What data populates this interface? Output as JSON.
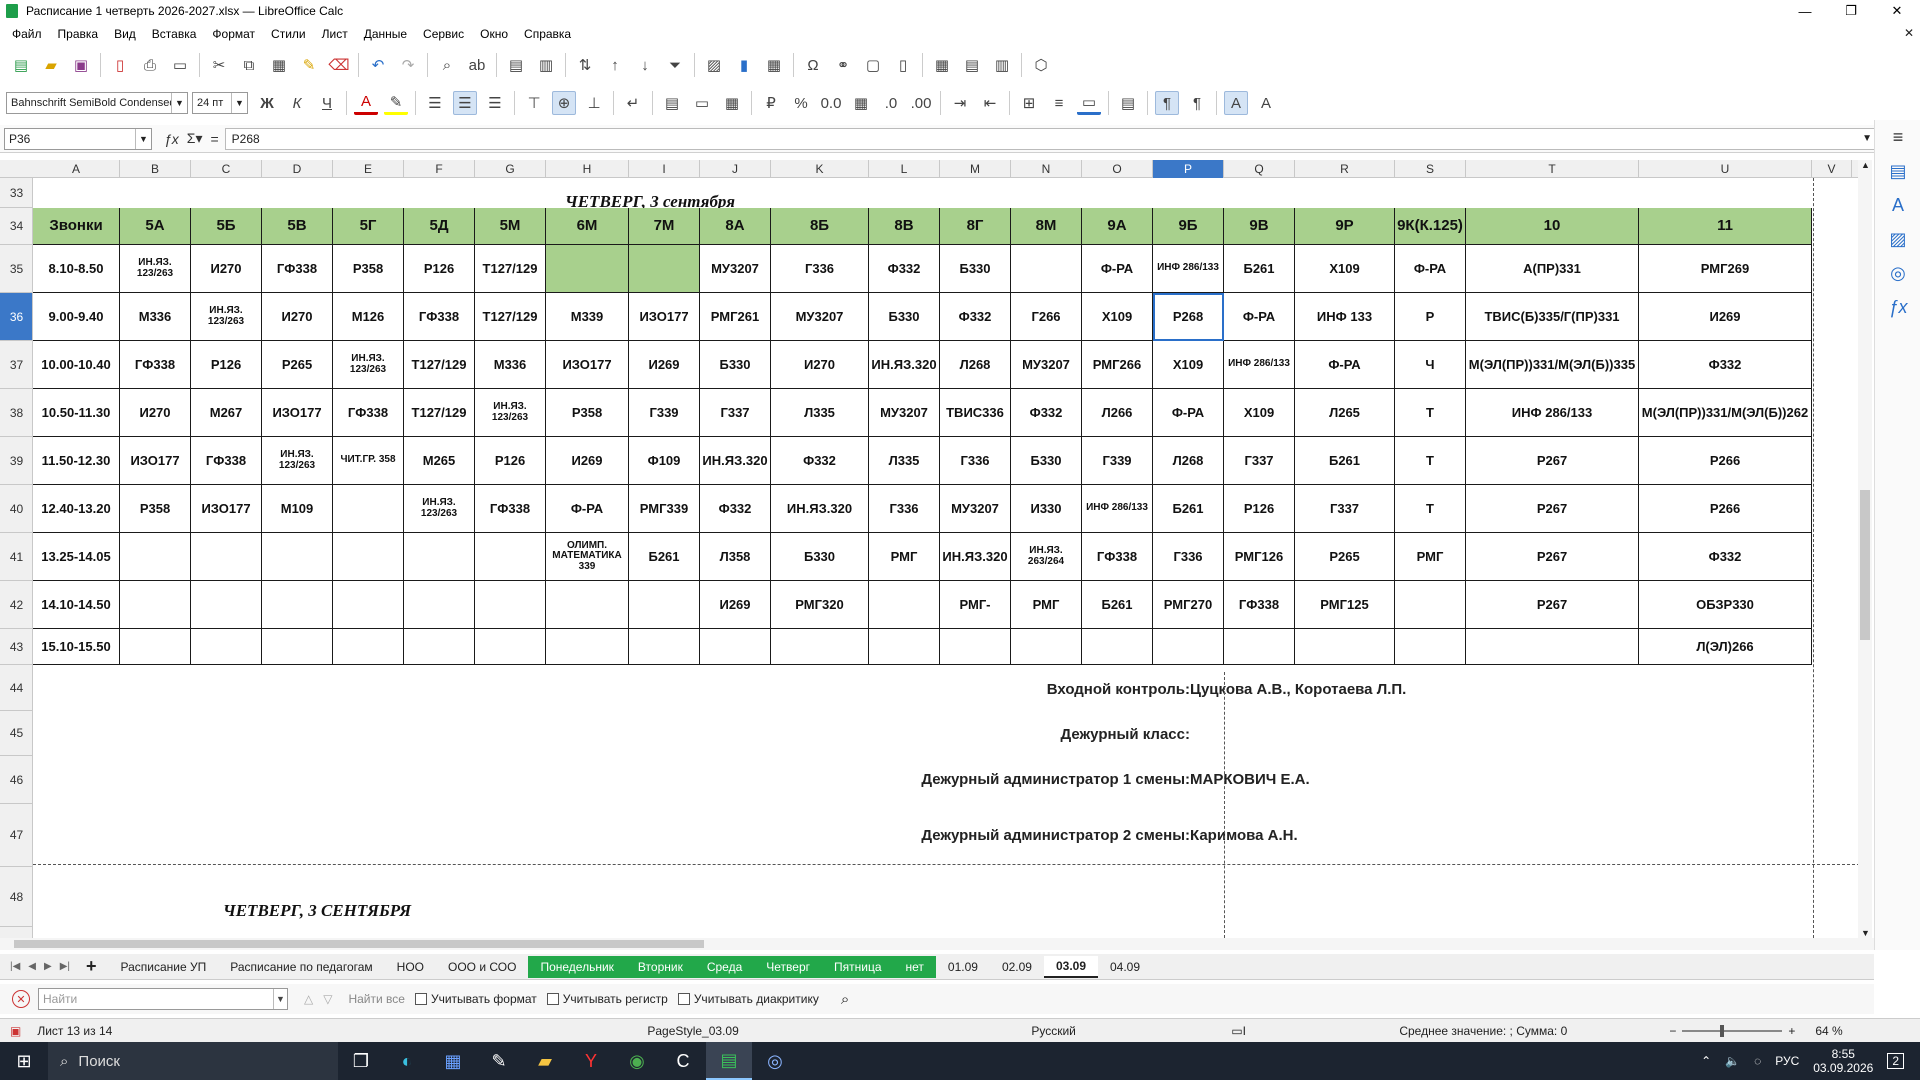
{
  "window": {
    "title": "Расписание 1 четверть 2026-2027.xlsx — LibreOffice Calc",
    "minimize": "—",
    "maximize": "❐",
    "close": "✕"
  },
  "menu": [
    "Файл",
    "Правка",
    "Вид",
    "Вставка",
    "Формат",
    "Стили",
    "Лист",
    "Данные",
    "Сервис",
    "Окно",
    "Справка"
  ],
  "font": {
    "name": "Bahnschrift SemiBold Condensed",
    "size": "24 пт"
  },
  "formula": {
    "cell_ref": "P36",
    "content": "Р268"
  },
  "columns": [
    "A",
    "B",
    "C",
    "D",
    "E",
    "F",
    "G",
    "H",
    "I",
    "J",
    "K",
    "L",
    "M",
    "N",
    "O",
    "P",
    "Q",
    "R",
    "S",
    "T",
    "U",
    "V"
  ],
  "selected_column": "P",
  "rows": [
    "33",
    "34",
    "35",
    "36",
    "37",
    "38",
    "39",
    "40",
    "41",
    "42",
    "43",
    "44",
    "45",
    "46",
    "47",
    "48"
  ],
  "selected_row": "36",
  "day_title_1": "ЧЕТВЕРГ, 3 сентября",
  "day_title_2": "ЧЕТВЕРГ, 3 СЕНТЯБРЯ",
  "schedule": {
    "header": [
      "Звонки",
      "5А",
      "5Б",
      "5В",
      "5Г",
      "5Д",
      "5М",
      "6М",
      "7М",
      "8А",
      "8Б",
      "8В",
      "8Г",
      "8М",
      "9А",
      "9Б",
      "9В",
      "9Р",
      "9К(К.125)",
      "10",
      "11"
    ],
    "rows": [
      [
        "8.10-8.50",
        "ИН.ЯЗ. 123/263",
        "И270",
        "ГФ338",
        "Р358",
        "Р126",
        "Т127/129",
        "",
        "",
        "МУ3207",
        "Г336",
        "Ф332",
        "Б330",
        "",
        "Ф-РА",
        "ИНФ 286/133",
        "Б261",
        "Х109",
        "Ф-РА",
        "А(ПР)331",
        "РМГ269"
      ],
      [
        "9.00-9.40",
        "М336",
        "ИН.ЯЗ. 123/263",
        "И270",
        "М126",
        "ГФ338",
        "Т127/129",
        "М339",
        "ИЗО177",
        "РМГ261",
        "МУ3207",
        "Б330",
        "Ф332",
        "Г266",
        "Х109",
        "Р268",
        "Ф-РА",
        "ИНФ 133",
        "Р",
        "ТВИС(Б)335/Г(ПР)331",
        "И269"
      ],
      [
        "10.00-10.40",
        "ГФ338",
        "Р126",
        "Р265",
        "ИН.ЯЗ. 123/263",
        "Т127/129",
        "М336",
        "ИЗО177",
        "И269",
        "Б330",
        "И270",
        "ИН.ЯЗ.320",
        "Л268",
        "МУ3207",
        "РМГ266",
        "Х109",
        "ИНФ 286/133",
        "Ф-РА",
        "Ч",
        "М(ЭЛ(ПР))331/М(ЭЛ(Б))335",
        "Ф332"
      ],
      [
        "10.50-11.30",
        "И270",
        "М267",
        "ИЗО177",
        "ГФ338",
        "Т127/129",
        "ИН.ЯЗ. 123/263",
        "Р358",
        "Г339",
        "Г337",
        "Л335",
        "МУ3207",
        "ТВИС336",
        "Ф332",
        "Л266",
        "Ф-РА",
        "Х109",
        "Л265",
        "Т",
        "ИНФ 286/133",
        "М(ЭЛ(ПР))331/М(ЭЛ(Б))262"
      ],
      [
        "11.50-12.30",
        "ИЗО177",
        "ГФ338",
        "ИН.ЯЗ. 123/263",
        "ЧИТ.ГР. 358",
        "М265",
        "Р126",
        "И269",
        "Ф109",
        "ИН.ЯЗ.320",
        "Ф332",
        "Л335",
        "Г336",
        "Б330",
        "Г339",
        "Л268",
        "Г337",
        "Б261",
        "Т",
        "Р267",
        "Р266"
      ],
      [
        "12.40-13.20",
        "Р358",
        "ИЗО177",
        "М109",
        "",
        "ИН.ЯЗ. 123/263",
        "ГФ338",
        "Ф-РА",
        "РМГ339",
        "Ф332",
        "ИН.ЯЗ.320",
        "Г336",
        "МУ3207",
        "И330",
        "ИНФ 286/133",
        "Б261",
        "Р126",
        "Г337",
        "Т",
        "Р267",
        "Р266"
      ],
      [
        "13.25-14.05",
        "",
        "",
        "",
        "",
        "",
        "",
        "ОЛИМП. МАТЕМАТИКА 339",
        "Б261",
        "Л358",
        "Б330",
        "РМГ",
        "ИН.ЯЗ.320",
        "ИН.ЯЗ. 263/264",
        "ГФ338",
        "Г336",
        "РМГ126",
        "Р265",
        "РМГ",
        "Р267",
        "Ф332"
      ],
      [
        "14.10-14.50",
        "",
        "",
        "",
        "",
        "",
        "",
        "",
        "",
        "И269",
        "РМГ320",
        "",
        "РМГ-",
        "РМГ",
        "Б261",
        "РМГ270",
        "ГФ338",
        "РМГ125",
        "",
        "Р267",
        "ОБЗР330"
      ],
      [
        "15.10-15.50",
        "",
        "",
        "",
        "",
        "",
        "",
        "",
        "",
        "",
        "",
        "",
        "",
        "",
        "",
        "",
        "",
        "",
        "",
        "",
        "Л(ЭЛ)266"
      ]
    ]
  },
  "info": {
    "entry_label": "Входной контроль:",
    "entry_value": "Цуцкова А.В., Коротаева Л.П.",
    "duty_class_label": "Дежурный класс:",
    "duty_class_value": "",
    "admin1_label": "Дежурный администратор 1 смены:",
    "admin1_value": "МАРКОВИЧ Е.А.",
    "admin2_label": "Дежурный администратор 2 смены:",
    "admin2_value": "Каримова А.Н."
  },
  "tabs": [
    {
      "label": "Расписание УП",
      "style": "normal"
    },
    {
      "label": "Расписание по педагогам",
      "style": "normal"
    },
    {
      "label": "НОО",
      "style": "normal"
    },
    {
      "label": "ООО и СОО",
      "style": "normal"
    },
    {
      "label": "Понедельник",
      "style": "green"
    },
    {
      "label": "Вторник",
      "style": "green"
    },
    {
      "label": "Среда",
      "style": "green"
    },
    {
      "label": "Четверг",
      "style": "green"
    },
    {
      "label": "Пятница",
      "style": "green"
    },
    {
      "label": "нет",
      "style": "green"
    },
    {
      "label": "01.09",
      "style": "normal"
    },
    {
      "label": "02.09",
      "style": "normal"
    },
    {
      "label": "03.09",
      "style": "active"
    },
    {
      "label": "04.09",
      "style": "normal"
    }
  ],
  "find": {
    "placeholder": "Найти",
    "find_all": "Найти все",
    "match_format": "Учитывать формат",
    "match_case": "Учитывать регистр",
    "diacritics": "Учитывать диакритику"
  },
  "status": {
    "sheet": "Лист 13 из 14",
    "page_style": "PageStyle_03.09",
    "language": "Русский",
    "summary": "Среднее значение: ; Сумма: 0",
    "zoom": "64 %"
  },
  "taskbar": {
    "search": "Поиск",
    "lang": "РУС",
    "time": "8:55",
    "date": "03.09.2026",
    "notifications": "2"
  }
}
